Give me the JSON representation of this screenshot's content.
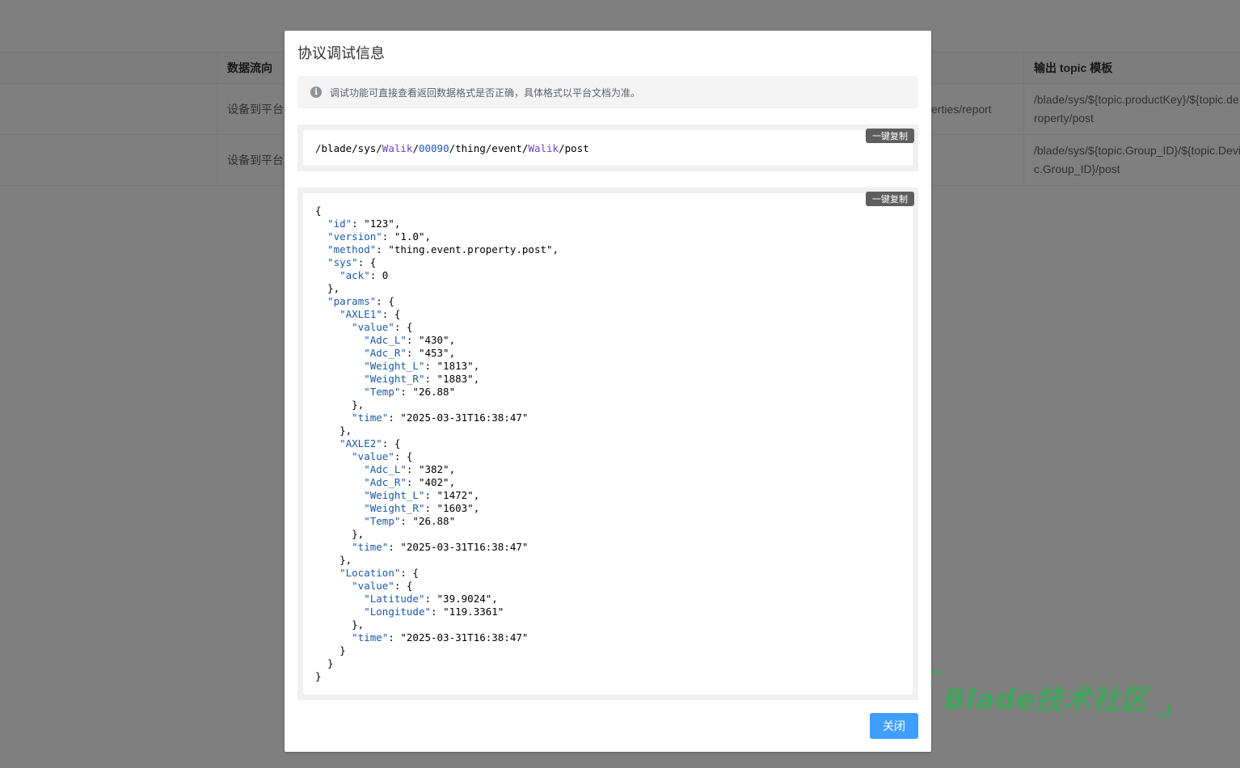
{
  "background_table": {
    "headers": {
      "data_flow": "数据流向",
      "output_topic_template": "输出 topic 模板"
    },
    "rows": [
      {
        "data_flow": "设备到平台",
        "middle": "erties/report",
        "output_topic_line1": "/blade/sys/${topic.productKey}/${topic.de",
        "output_topic_line2": "roperty/post"
      },
      {
        "data_flow": "设备到平台",
        "middle": "",
        "output_topic_line1": "/blade/sys/${topic.Group_ID}/${topic.Devi",
        "output_topic_line2": "c.Group_ID}/post"
      }
    ]
  },
  "watermark": {
    "text": "Blade技术社区"
  },
  "dialog": {
    "title": "协议调试信息",
    "alert": "调试功能可直接查看返回数据格式是否正确，具体格式以平台文档为准。",
    "copy_label": "一键复制",
    "topic": {
      "p1": "/blade/sys/",
      "p2": "Walik",
      "p3": "/",
      "p4": "00090",
      "p5": "/thing/event/",
      "p6": "Walik",
      "p7": "/post"
    },
    "json_text": "{\n  \"id\": \"123\",\n  \"version\": \"1.0\",\n  \"method\": \"thing.event.property.post\",\n  \"sys\": {\n    \"ack\": 0\n  },\n  \"params\": {\n    \"AXLE1\": {\n      \"value\": {\n        \"Adc_L\": \"430\",\n        \"Adc_R\": \"453\",\n        \"Weight_L\": \"1813\",\n        \"Weight_R\": \"1883\",\n        \"Temp\": \"26.88\"\n      },\n      \"time\": \"2025-03-31T16:38:47\"\n    },\n    \"AXLE2\": {\n      \"value\": {\n        \"Adc_L\": \"382\",\n        \"Adc_R\": \"402\",\n        \"Weight_L\": \"1472\",\n        \"Weight_R\": \"1603\",\n        \"Temp\": \"26.88\"\n      },\n      \"time\": \"2025-03-31T16:38:47\"\n    },\n    \"Location\": {\n      \"value\": {\n        \"Latitude\": \"39.9024\",\n        \"Longitude\": \"119.3361\"\n      },\n      \"time\": \"2025-03-31T16:38:47\"\n    }\n  }\n}",
    "close_label": "关闭"
  },
  "colors": {
    "primary": "#409eff",
    "mask": "rgba(0,0,0,0.5)",
    "watermark": "#3fa55b"
  }
}
